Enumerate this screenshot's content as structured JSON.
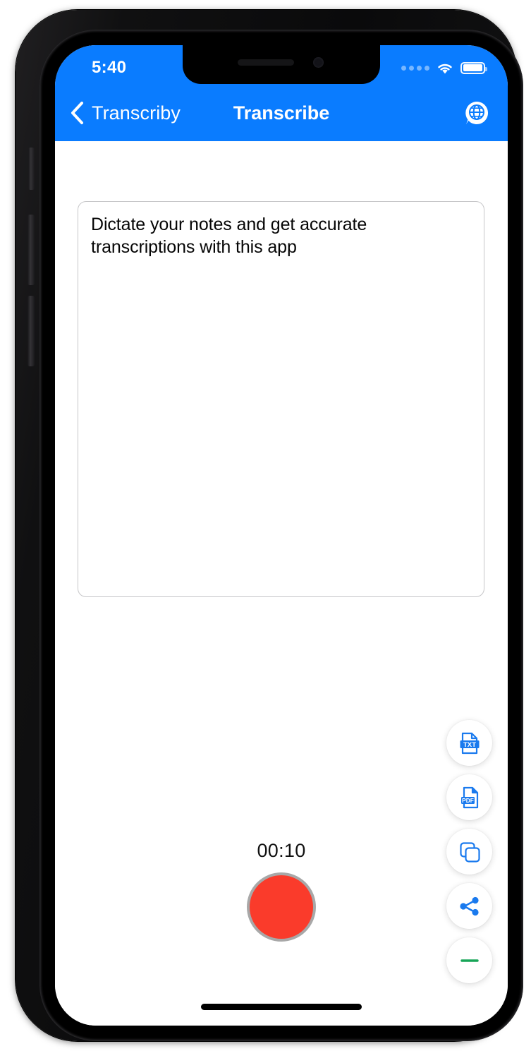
{
  "device": {
    "type": "iphone-mockup",
    "hardware_buttons": [
      "mute-switch",
      "volume-up",
      "volume-down",
      "power"
    ]
  },
  "status_bar": {
    "time": "5:40",
    "signal_icon": "signal-dots-icon",
    "wifi_icon": "wifi-icon",
    "battery_icon": "battery-icon",
    "background_color": "#0a7cff"
  },
  "nav_bar": {
    "back_label": "Transcriby",
    "back_icon": "chevron-left-icon",
    "title": "Transcribe",
    "action_icon": "globe-chat-icon",
    "background_color": "#0a7cff",
    "text_color": "#ffffff"
  },
  "transcript": {
    "text": "Dictate your notes and get accurate transcriptions with this app",
    "placeholder": "Dictate your notes and get accurate transcriptions with this app",
    "border_color": "#c6c6c8"
  },
  "recorder": {
    "timer": "00:10",
    "record_button_name": "record-stop-button",
    "record_color": "#fa3b2b",
    "record_ring_color": "#a8a8a8"
  },
  "fab_menu": {
    "accent_color": "#1a7aee",
    "items": [
      {
        "name": "export-txt-button",
        "icon": "txt-file-icon",
        "label": "TXT"
      },
      {
        "name": "export-pdf-button",
        "icon": "pdf-file-icon",
        "label": "PDF"
      },
      {
        "name": "copy-button",
        "icon": "copy-icon",
        "label": ""
      },
      {
        "name": "share-button",
        "icon": "share-icon",
        "label": ""
      },
      {
        "name": "collapse-menu-button",
        "icon": "minus-icon",
        "label": "",
        "color": "#18a558"
      }
    ]
  },
  "home_indicator": {
    "name": "home-indicator"
  }
}
